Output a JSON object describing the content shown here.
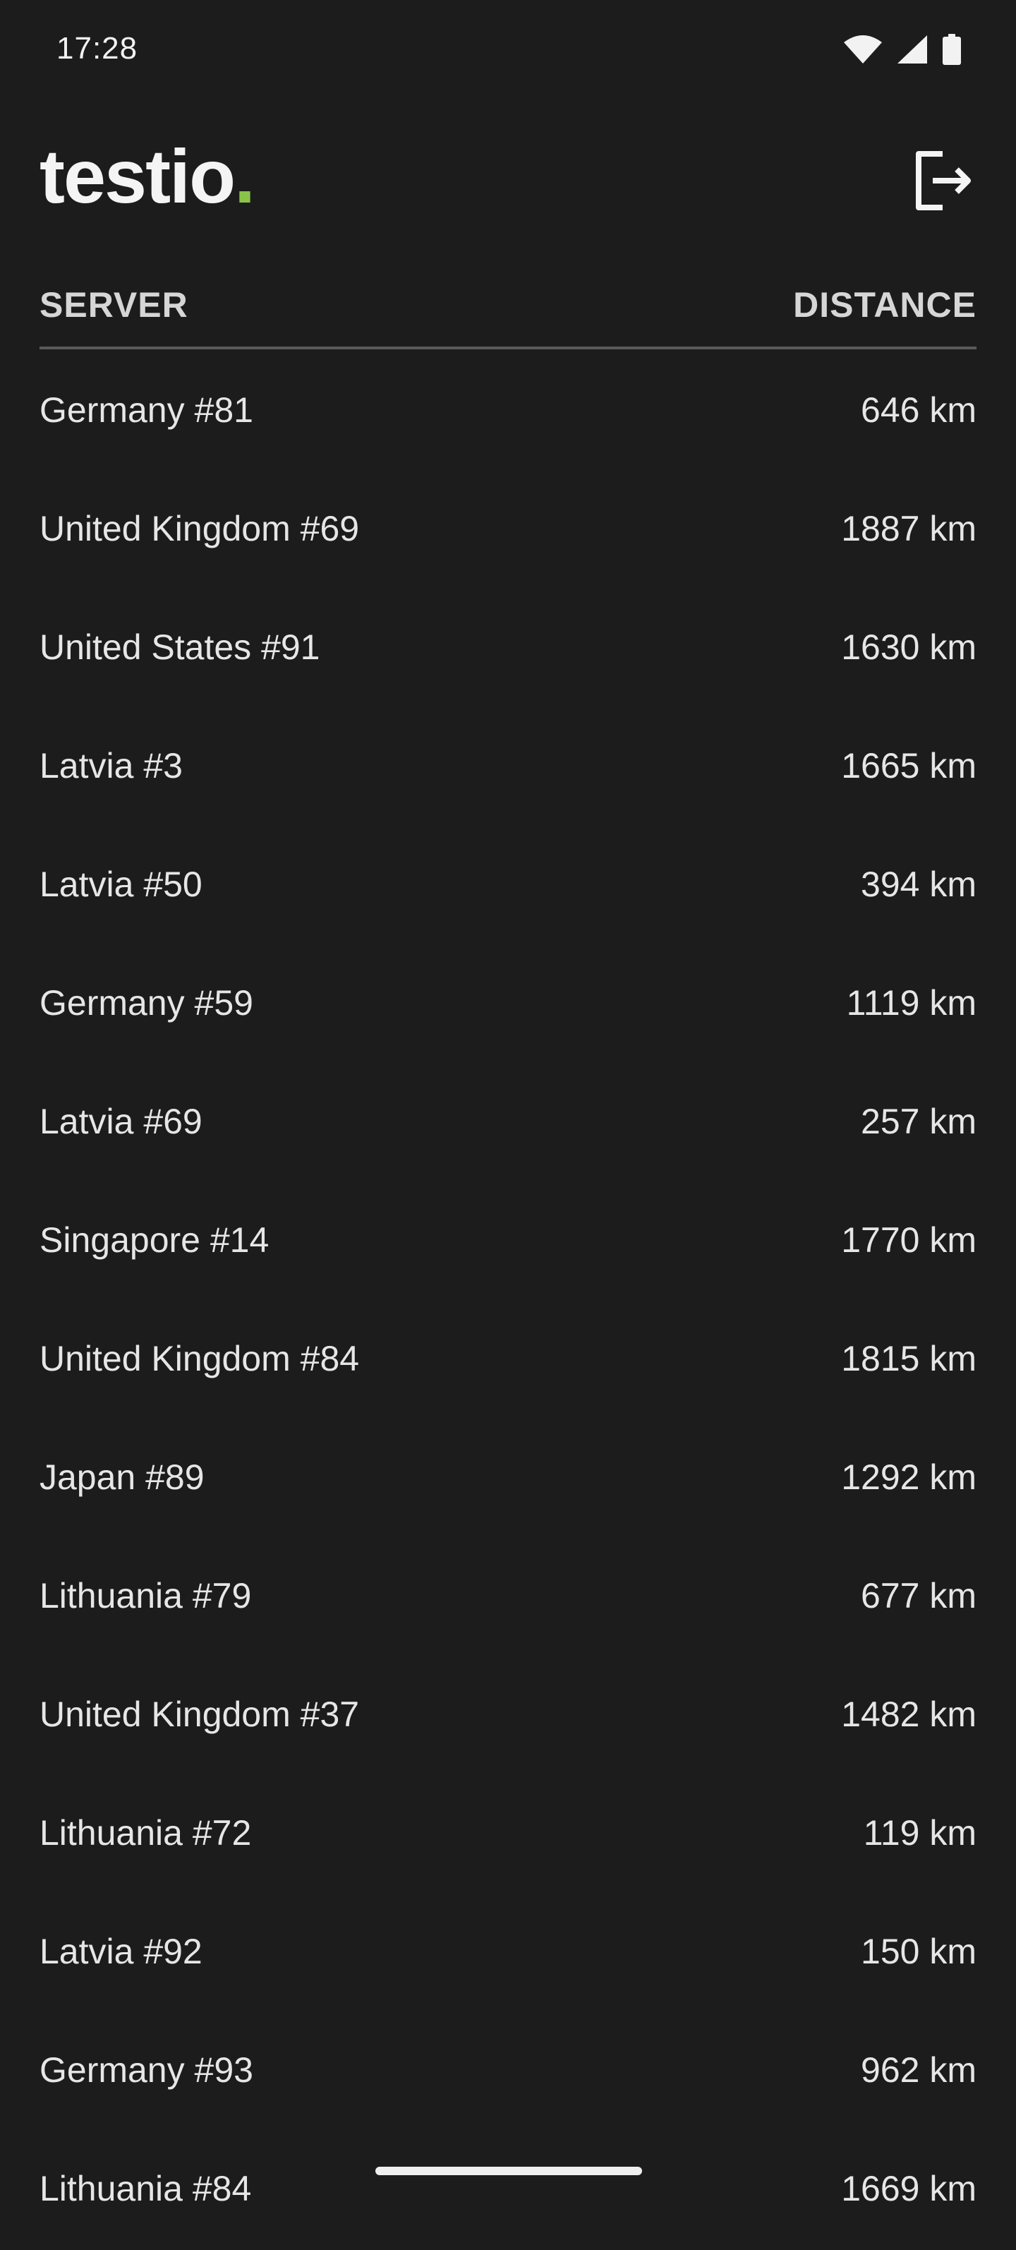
{
  "status_bar": {
    "time": "17:28",
    "icons": [
      "wifi-icon",
      "signal-icon",
      "battery-icon"
    ]
  },
  "header": {
    "logo_text": "testio",
    "logo_dot": ".",
    "logo_dot_color": "#8bc34a",
    "logout_icon": "logout-icon"
  },
  "table": {
    "columns": {
      "server": "SERVER",
      "distance": "DISTANCE"
    },
    "rows": [
      {
        "server": "Germany #81",
        "distance": "646 km"
      },
      {
        "server": "United Kingdom #69",
        "distance": "1887 km"
      },
      {
        "server": "United States #91",
        "distance": "1630 km"
      },
      {
        "server": "Latvia #3",
        "distance": "1665 km"
      },
      {
        "server": "Latvia #50",
        "distance": "394 km"
      },
      {
        "server": "Germany #59",
        "distance": "1119 km"
      },
      {
        "server": "Latvia #69",
        "distance": "257 km"
      },
      {
        "server": "Singapore #14",
        "distance": "1770 km"
      },
      {
        "server": "United Kingdom #84",
        "distance": "1815 km"
      },
      {
        "server": "Japan #89",
        "distance": "1292 km"
      },
      {
        "server": "Lithuania #79",
        "distance": "677 km"
      },
      {
        "server": "United Kingdom #37",
        "distance": "1482 km"
      },
      {
        "server": "Lithuania #72",
        "distance": "119 km"
      },
      {
        "server": "Latvia #92",
        "distance": "150 km"
      },
      {
        "server": "Germany #93",
        "distance": "962 km"
      },
      {
        "server": "Lithuania #84",
        "distance": "1669 km"
      }
    ]
  },
  "colors": {
    "background": "#1c1c1d",
    "text": "#e6e6e6",
    "accent": "#8bc34a"
  }
}
